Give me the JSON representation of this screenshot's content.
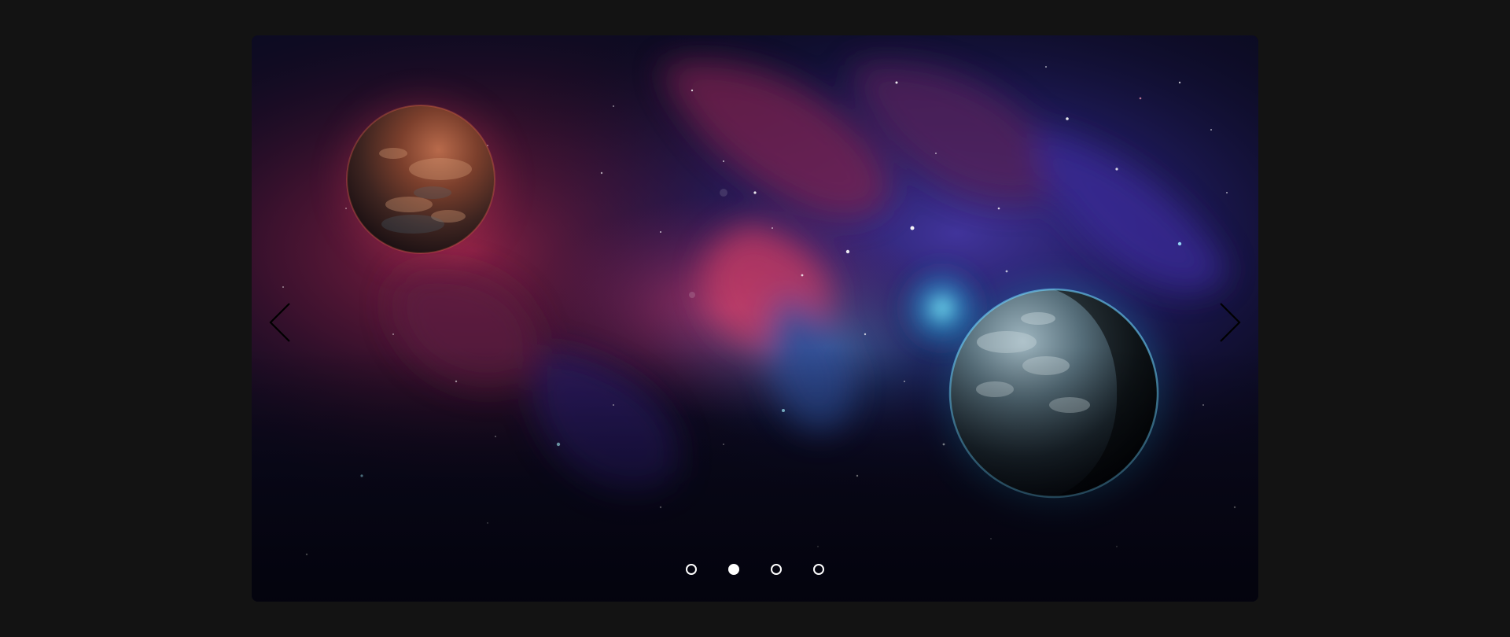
{
  "carousel": {
    "slide_count": 4,
    "active_index": 1,
    "slides": [
      {
        "scene": "space-nebula-with-two-planets"
      },
      {
        "scene": "space-nebula-with-two-planets"
      },
      {
        "scene": "space-nebula-with-two-planets"
      },
      {
        "scene": "space-nebula-with-two-planets"
      }
    ],
    "controls": {
      "prev_icon": "chevron-left-icon",
      "next_icon": "chevron-right-icon"
    }
  },
  "colors": {
    "page_background": "#131313",
    "dot_color": "#ffffff",
    "arrow_color": "#000000",
    "nebula_red": "#9a1f3a",
    "nebula_blue": "#2b2f8f",
    "planet_red": "#8a3a25",
    "planet_blue_glow": "#4fd6ff"
  }
}
